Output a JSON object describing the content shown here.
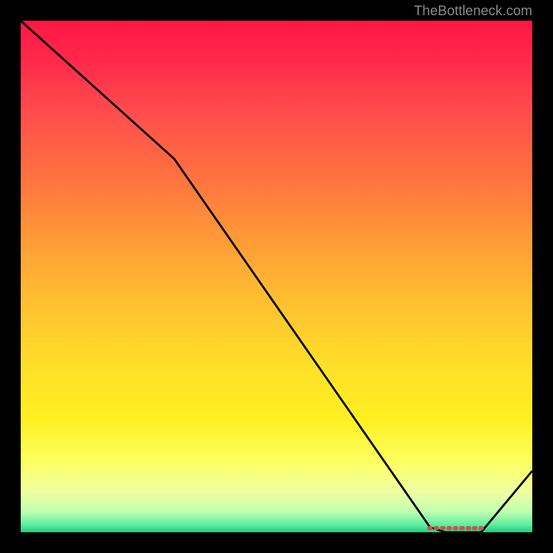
{
  "watermark": "TheBottleneck.com",
  "chart_data": {
    "type": "line",
    "title": "",
    "xlabel": "",
    "ylabel": "",
    "x": [
      0,
      0.3,
      0.8,
      0.83,
      0.9,
      1.0
    ],
    "values": [
      1.0,
      0.73,
      0.01,
      0.0,
      0.0,
      0.12
    ],
    "ylim": [
      0,
      1
    ],
    "xlim": [
      0,
      1
    ],
    "gradient_stops": [
      {
        "offset": 0.0,
        "color": "#ff1744"
      },
      {
        "offset": 0.08,
        "color": "#ff2a4a"
      },
      {
        "offset": 0.18,
        "color": "#ff4d4d"
      },
      {
        "offset": 0.3,
        "color": "#ff7040"
      },
      {
        "offset": 0.42,
        "color": "#ff9838"
      },
      {
        "offset": 0.55,
        "color": "#ffc030"
      },
      {
        "offset": 0.68,
        "color": "#ffe028"
      },
      {
        "offset": 0.78,
        "color": "#fff020"
      },
      {
        "offset": 0.86,
        "color": "#fcff60"
      },
      {
        "offset": 0.92,
        "color": "#f0ffa0"
      },
      {
        "offset": 0.96,
        "color": "#c0ffb0"
      },
      {
        "offset": 0.985,
        "color": "#60eea0"
      },
      {
        "offset": 1.0,
        "color": "#20cc80"
      }
    ],
    "marker_region": {
      "start_x": 0.8,
      "end_x": 0.9,
      "y": 0.0
    },
    "marker_color": "#d05050"
  }
}
